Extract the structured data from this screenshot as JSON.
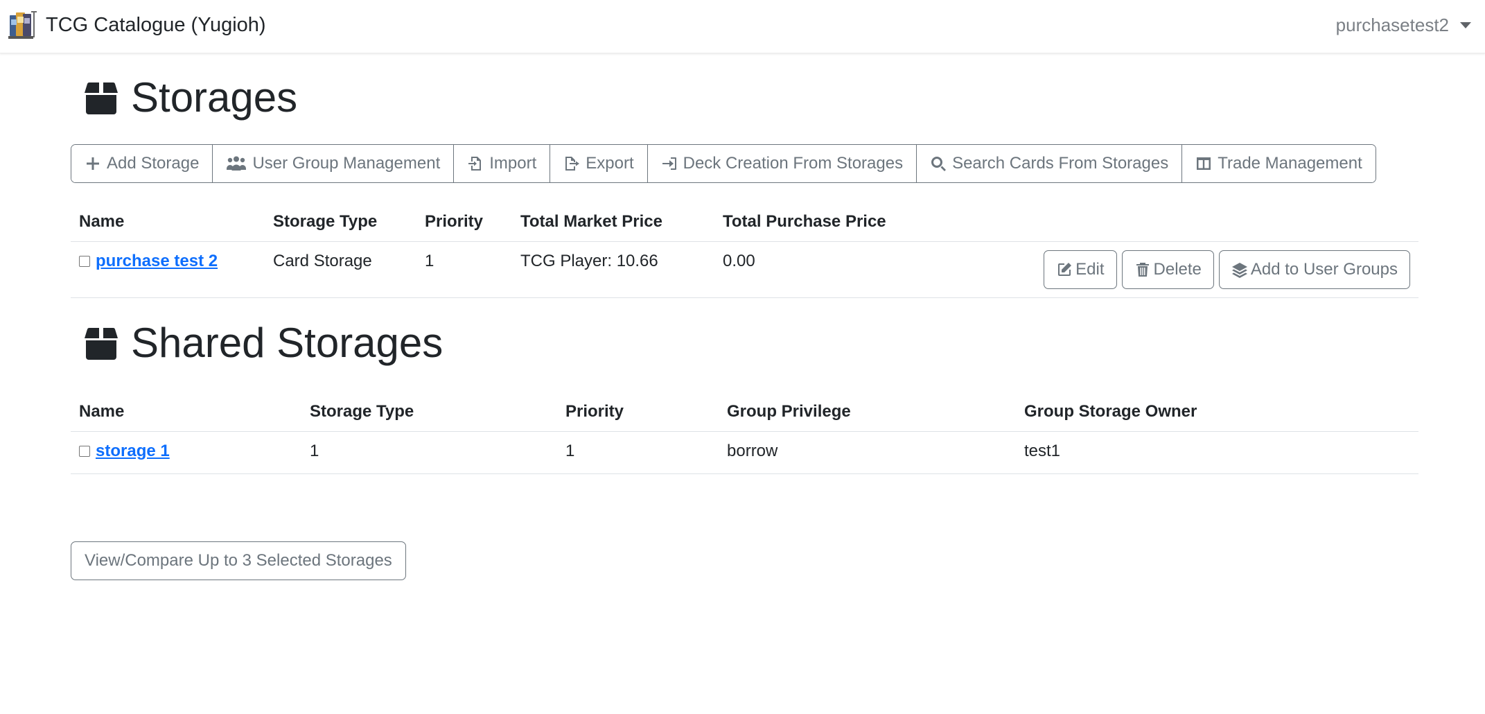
{
  "navbar": {
    "brand": "TCG Catalogue (Yugioh)",
    "username": "purchasetest2"
  },
  "storages": {
    "title": "Storages",
    "toolbar": [
      {
        "label": "Add Storage",
        "icon": "plus-icon"
      },
      {
        "label": "User Group Management",
        "icon": "users-icon"
      },
      {
        "label": "Import",
        "icon": "file-import-icon"
      },
      {
        "label": "Export",
        "icon": "file-export-icon"
      },
      {
        "label": "Deck Creation From Storages",
        "icon": "sign-in-arrow-icon"
      },
      {
        "label": "Search Cards From Storages",
        "icon": "search-icon"
      },
      {
        "label": "Trade Management",
        "icon": "columns-icon"
      }
    ],
    "columns": [
      "Name",
      "Storage Type",
      "Priority",
      "Total Market Price",
      "Total Purchase Price"
    ],
    "rows": [
      {
        "name": "purchase test 2",
        "storage_type": "Card Storage",
        "priority": "1",
        "market_price": "TCG Player: 10.66",
        "purchase_price": "0.00"
      }
    ],
    "row_actions": {
      "edit": "Edit",
      "delete": "Delete",
      "add_groups": "Add to User Groups"
    }
  },
  "shared": {
    "title": "Shared Storages",
    "columns": [
      "Name",
      "Storage Type",
      "Priority",
      "Group Privilege",
      "Group Storage Owner"
    ],
    "rows": [
      {
        "name": "storage 1",
        "storage_type": "1",
        "priority": "1",
        "privilege": "borrow",
        "owner": "test1"
      }
    ]
  },
  "compare_label": "View/Compare Up to 3 Selected Storages"
}
